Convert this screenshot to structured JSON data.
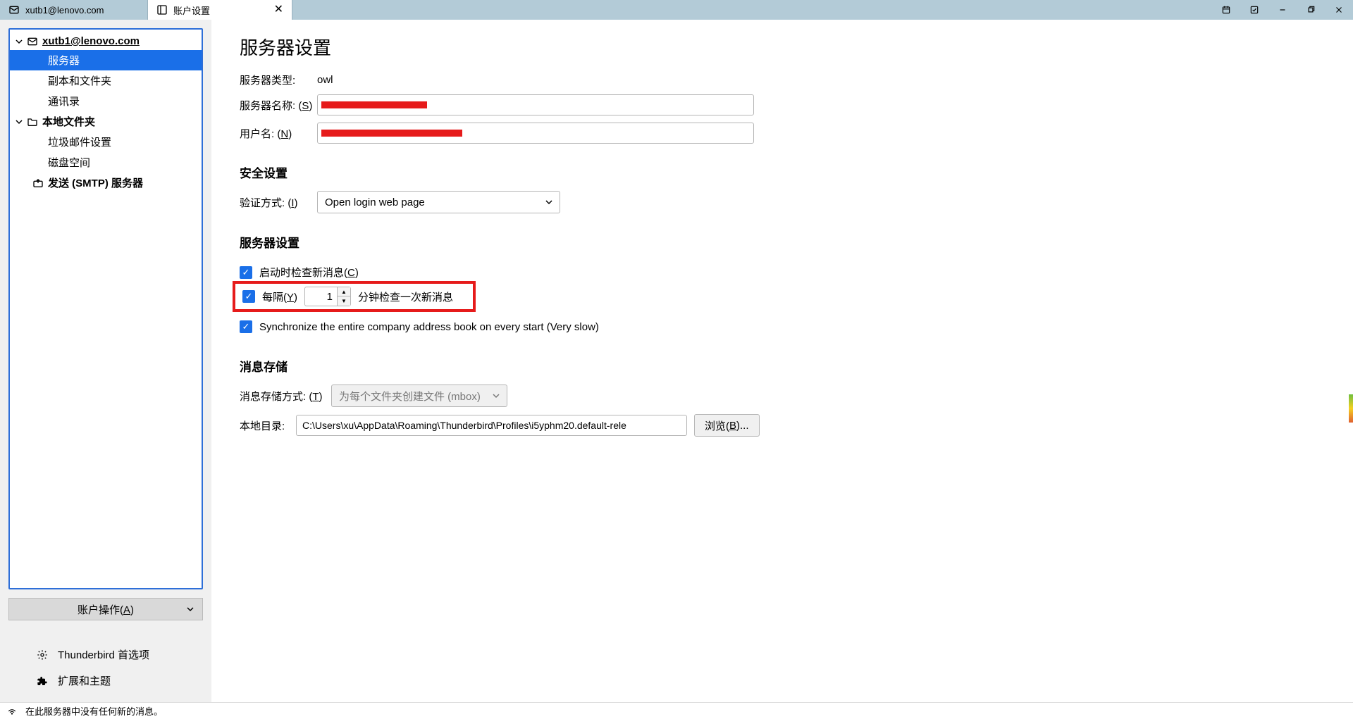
{
  "tabs": {
    "mail": {
      "label": "xutb1@lenovo.com"
    },
    "settings": {
      "label": "账户设置"
    }
  },
  "sidebar": {
    "account": "xutb1@lenovo.com",
    "items": {
      "server": "服务器",
      "copies": "副本和文件夹",
      "addressbook": "通讯录"
    },
    "local": "本地文件夹",
    "local_items": {
      "junk": "垃圾邮件设置",
      "disk": "磁盘空间"
    },
    "smtp": "发送 (SMTP) 服务器",
    "actions_label": "账户操作(",
    "actions_mnemonic": "A",
    "actions_label_close": ")"
  },
  "bottom": {
    "prefs": "Thunderbird 首选项",
    "addons": "扩展和主题"
  },
  "content": {
    "title": "服务器设置",
    "server_type_label": "服务器类型:",
    "server_type_value": "owl",
    "server_name_label": "服务器名称:  (",
    "server_name_mn": "S",
    "server_name_label_close": ")",
    "username_label": "用户名:  (",
    "username_mn": "N",
    "username_label_close": ")",
    "security_heading": "安全设置",
    "auth_label": "验证方式:  (",
    "auth_mn": "I",
    "auth_label_close": ")",
    "auth_value": "Open login web page",
    "server_settings_heading": "服务器设置",
    "check_start_label": "启动时检查新消息(",
    "check_start_mn": "C",
    "check_start_close": ")",
    "every_label": "每隔(",
    "every_mn": "Y",
    "every_close": ")",
    "every_value": "1",
    "every_suffix": "分钟检查一次新消息",
    "sync_label": "Synchronize the entire company address book on every start (Very slow)",
    "storage_heading": "消息存储",
    "storage_mode_label": "消息存储方式:  (",
    "storage_mode_mn": "T",
    "storage_mode_close": ")",
    "storage_mode_value": "为每个文件夹创建文件 (mbox)",
    "local_dir_label": "本地目录:",
    "local_dir_value": "C:\\Users\\xu\\AppData\\Roaming\\Thunderbird\\Profiles\\i5yphm20.default-rele",
    "browse_label": "浏览(",
    "browse_mn": "B",
    "browse_close": ")..."
  },
  "status": {
    "message": "在此服务器中没有任何新的消息。"
  }
}
